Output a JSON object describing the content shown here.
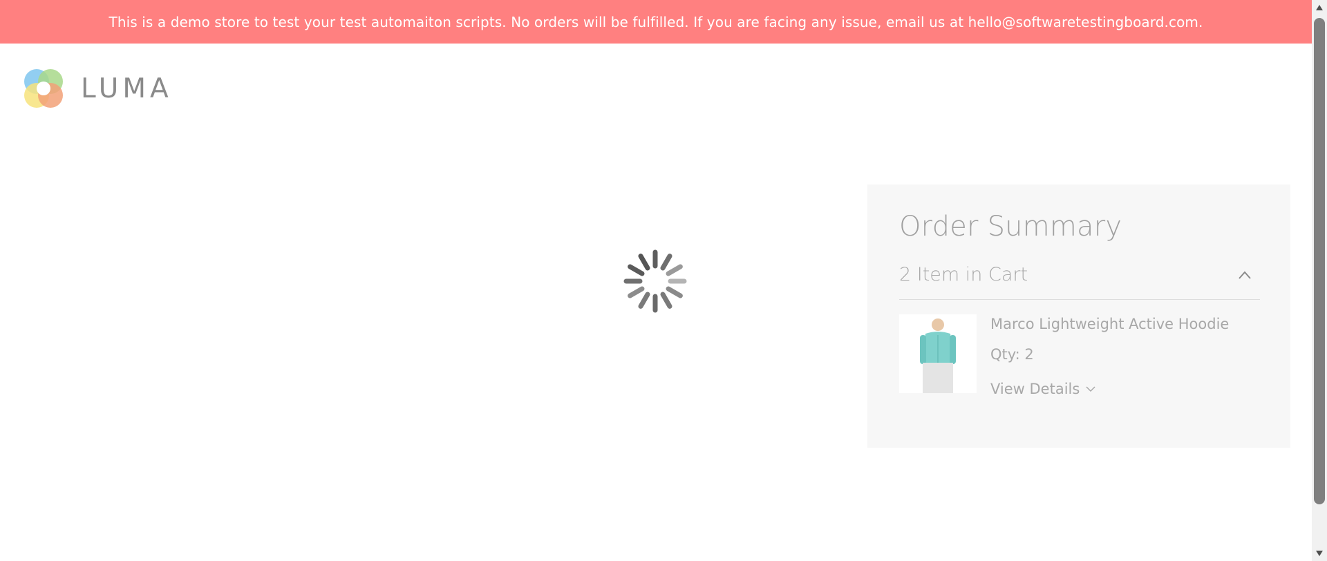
{
  "banner": {
    "text": "This is a demo store to test your test automaiton scripts. No orders will be fulfilled. If you are facing any issue, email us at hello@softwaretestingboard.com."
  },
  "header": {
    "logo_text": "LUMA"
  },
  "loader": {
    "icon": "loading-spinner-icon"
  },
  "order_summary": {
    "title": "Order Summary",
    "cart_count": "2 Item in Cart",
    "items": [
      {
        "name": "Marco Lightweight Active Hoodie",
        "qty": "Qty: 2",
        "view_details": "View Details"
      }
    ]
  },
  "colors": {
    "banner_bg": "#ff8080",
    "summary_bg": "#f7f7f7",
    "muted_text": "#a8a8a8",
    "scrollbar_thumb": "#7f7f7f"
  }
}
